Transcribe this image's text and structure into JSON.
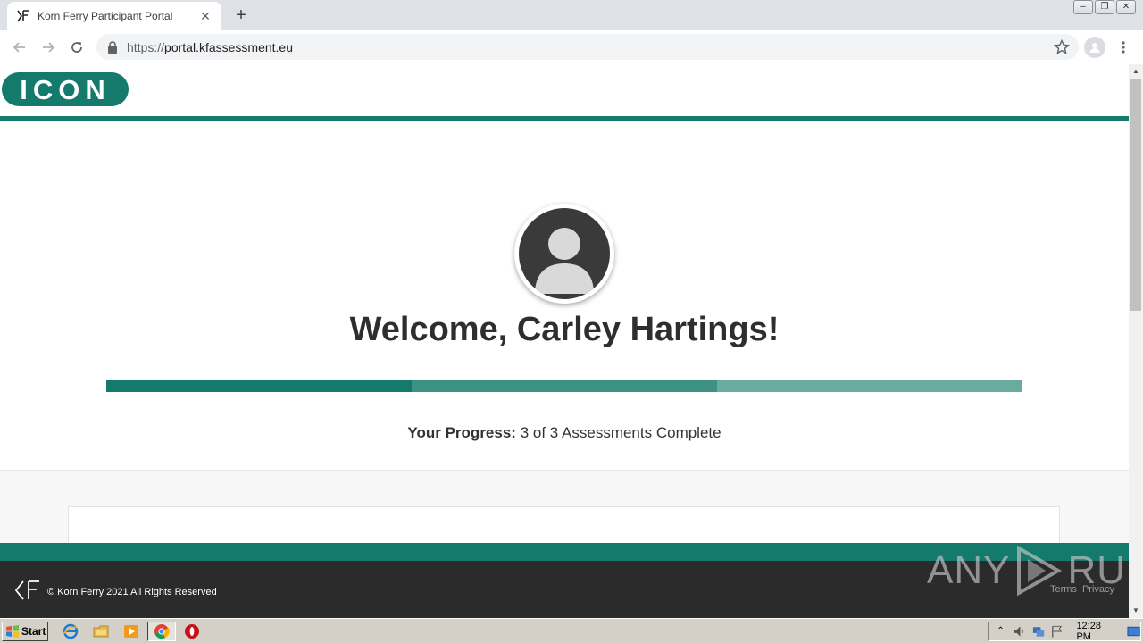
{
  "browser": {
    "tab_title": "Korn Ferry Participant Portal",
    "tab_close": "✕",
    "new_tab": "+",
    "url_scheme": "https://",
    "url_host": "portal.kfassessment.eu",
    "window_controls": [
      "–",
      "❐",
      "✕"
    ]
  },
  "site": {
    "logo_text": "ICON",
    "welcome": "Welcome, Carley Hartings!",
    "progress_label": "Your Progress:",
    "progress_value": "3 of 3 Assessments Complete",
    "progress_completed": 3,
    "progress_total": 3,
    "progress_colors": [
      "#137a6c",
      "#3d9283",
      "#6aab9f"
    ]
  },
  "footer": {
    "copyright": "© Korn Ferry 2021 All Rights Reserved",
    "links": [
      "Terms",
      "Privacy"
    ]
  },
  "watermark": {
    "left": "ANY",
    "right": "RUN"
  },
  "taskbar": {
    "start_label": "Start",
    "clock": "12:28 PM"
  },
  "colors": {
    "brand_teal": "#137a6c",
    "footer_dark": "#2b2b2b"
  }
}
